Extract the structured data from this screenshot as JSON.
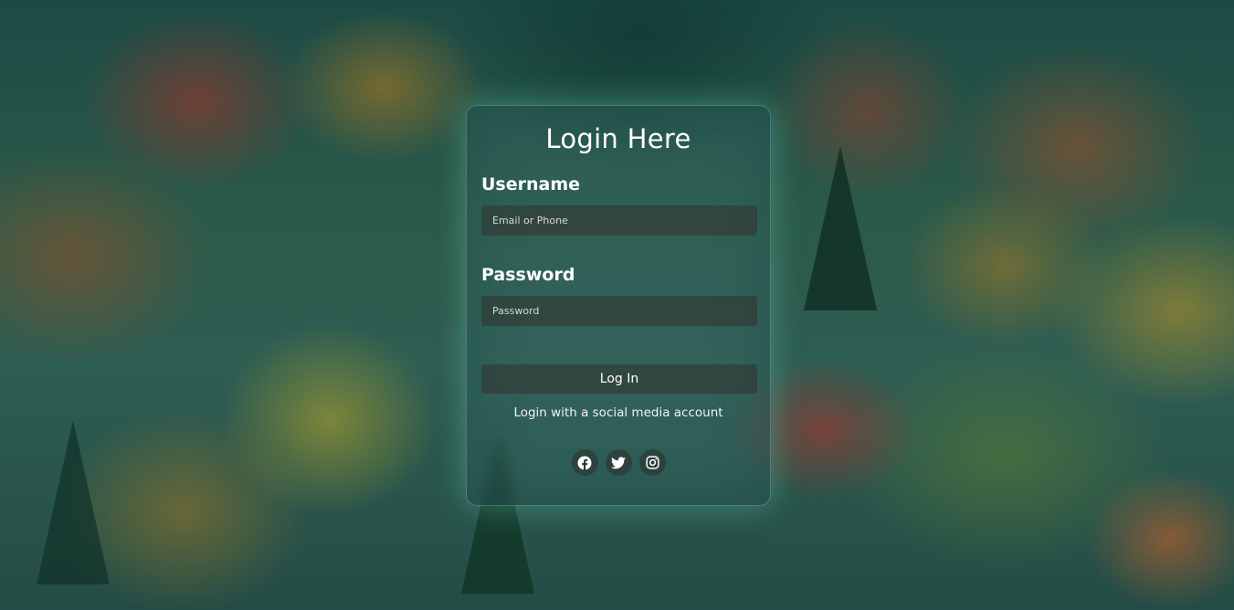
{
  "form": {
    "title": "Login Here",
    "username_label": "Username",
    "username_placeholder": "Email or Phone",
    "password_label": "Password",
    "password_placeholder": "Password",
    "login_button": "Log In",
    "social_text": "Login with a social media account"
  },
  "social": [
    {
      "name": "facebook",
      "icon": "facebook-icon"
    },
    {
      "name": "twitter",
      "icon": "twitter-icon"
    },
    {
      "name": "instagram",
      "icon": "instagram-icon"
    }
  ],
  "colors": {
    "text": "#ffffff",
    "card_glow": "#78f0c8",
    "field_background": "#373c37"
  }
}
